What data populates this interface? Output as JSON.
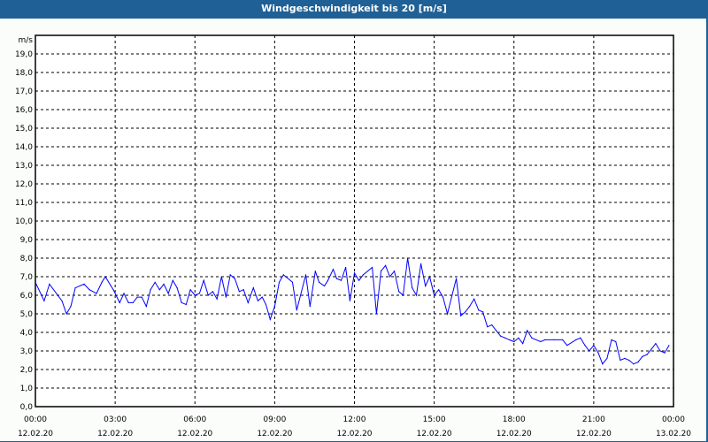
{
  "window_title": "Windgeschwindigkeit bis 20 [m/s]",
  "chart_data": {
    "type": "line",
    "title": "Windgeschwindigkeit bis 20 [m/s]",
    "ylabel": "m/s",
    "xlabel": "",
    "ylim": [
      0,
      20
    ],
    "xlim_hours": [
      0,
      24
    ],
    "grid": true,
    "y_ticks": [
      "0,0",
      "1,0",
      "2,0",
      "3,0",
      "4,0",
      "5,0",
      "6,0",
      "7,0",
      "8,0",
      "9,0",
      "10,0",
      "11,0",
      "12,0",
      "13,0",
      "14,0",
      "15,0",
      "16,0",
      "17,0",
      "18,0",
      "19,0"
    ],
    "x_ticks": [
      {
        "time": "00:00",
        "date": "12.02.20"
      },
      {
        "time": "03:00",
        "date": "12.02.20"
      },
      {
        "time": "06:00",
        "date": "12.02.20"
      },
      {
        "time": "09:00",
        "date": "12.02.20"
      },
      {
        "time": "12:00",
        "date": "12.02.20"
      },
      {
        "time": "15:00",
        "date": "12.02.20"
      },
      {
        "time": "18:00",
        "date": "12.02.20"
      },
      {
        "time": "21:00",
        "date": "12.02.20"
      },
      {
        "time": "00:00",
        "date": "13.02.20"
      }
    ],
    "series": [
      {
        "name": "Windgeschwindigkeit",
        "color": "#0000ff",
        "points": [
          [
            0.03,
            6.6
          ],
          [
            0.33,
            5.7
          ],
          [
            0.53,
            6.6
          ],
          [
            1.0,
            5.7
          ],
          [
            1.17,
            5.0
          ],
          [
            1.33,
            5.4
          ],
          [
            1.5,
            6.4
          ],
          [
            1.83,
            6.6
          ],
          [
            2.03,
            6.3
          ],
          [
            2.3,
            6.1
          ],
          [
            2.5,
            6.7
          ],
          [
            2.63,
            7.0
          ],
          [
            2.93,
            6.3
          ],
          [
            3.17,
            5.6
          ],
          [
            3.33,
            6.1
          ],
          [
            3.5,
            5.6
          ],
          [
            3.67,
            5.6
          ],
          [
            3.83,
            5.9
          ],
          [
            4.0,
            5.9
          ],
          [
            4.17,
            5.4
          ],
          [
            4.33,
            6.3
          ],
          [
            4.5,
            6.7
          ],
          [
            4.67,
            6.3
          ],
          [
            4.83,
            6.6
          ],
          [
            5.0,
            6.1
          ],
          [
            5.17,
            6.8
          ],
          [
            5.33,
            6.4
          ],
          [
            5.5,
            5.6
          ],
          [
            5.67,
            5.5
          ],
          [
            5.83,
            6.3
          ],
          [
            6.0,
            6.0
          ],
          [
            6.17,
            6.1
          ],
          [
            6.33,
            6.8
          ],
          [
            6.5,
            6.0
          ],
          [
            6.67,
            6.2
          ],
          [
            6.83,
            5.8
          ],
          [
            7.0,
            7.0
          ],
          [
            7.17,
            5.9
          ],
          [
            7.33,
            7.1
          ],
          [
            7.5,
            6.9
          ],
          [
            7.67,
            6.2
          ],
          [
            7.83,
            6.3
          ],
          [
            8.0,
            5.6
          ],
          [
            8.2,
            6.4
          ],
          [
            8.37,
            5.7
          ],
          [
            8.53,
            5.9
          ],
          [
            8.67,
            5.5
          ],
          [
            8.83,
            4.7
          ],
          [
            9.0,
            5.4
          ],
          [
            9.17,
            6.7
          ],
          [
            9.33,
            7.1
          ],
          [
            9.67,
            6.7
          ],
          [
            9.83,
            5.2
          ],
          [
            10.17,
            7.1
          ],
          [
            10.33,
            5.4
          ],
          [
            10.53,
            7.3
          ],
          [
            10.67,
            6.7
          ],
          [
            10.87,
            6.5
          ],
          [
            11.0,
            6.8
          ],
          [
            11.2,
            7.4
          ],
          [
            11.33,
            6.9
          ],
          [
            11.5,
            6.8
          ],
          [
            11.67,
            7.5
          ],
          [
            11.83,
            5.7
          ],
          [
            12.0,
            7.2
          ],
          [
            12.17,
            6.8
          ],
          [
            12.33,
            7.1
          ],
          [
            12.67,
            7.5
          ],
          [
            12.83,
            5.0
          ],
          [
            13.0,
            7.3
          ],
          [
            13.17,
            7.6
          ],
          [
            13.33,
            7.0
          ],
          [
            13.5,
            7.3
          ],
          [
            13.67,
            6.2
          ],
          [
            13.83,
            6.0
          ],
          [
            14.0,
            8.0
          ],
          [
            14.17,
            6.4
          ],
          [
            14.33,
            6.0
          ],
          [
            14.5,
            7.7
          ],
          [
            14.67,
            6.5
          ],
          [
            14.83,
            7.0
          ],
          [
            15.0,
            6.0
          ],
          [
            15.17,
            6.3
          ],
          [
            15.33,
            5.9
          ],
          [
            15.5,
            5.0
          ],
          [
            15.67,
            6.0
          ],
          [
            15.83,
            6.9
          ],
          [
            16.0,
            4.9
          ],
          [
            16.17,
            5.1
          ],
          [
            16.33,
            5.4
          ],
          [
            16.5,
            5.8
          ],
          [
            16.67,
            5.2
          ],
          [
            16.83,
            5.1
          ],
          [
            17.0,
            4.3
          ],
          [
            17.17,
            4.4
          ],
          [
            17.33,
            4.1
          ],
          [
            17.5,
            3.8
          ],
          [
            17.67,
            3.7
          ],
          [
            17.83,
            3.6
          ],
          [
            18.0,
            3.5
          ],
          [
            18.17,
            3.7
          ],
          [
            18.33,
            3.4
          ],
          [
            18.5,
            4.1
          ],
          [
            18.67,
            3.7
          ],
          [
            19.0,
            3.5
          ],
          [
            19.17,
            3.6
          ],
          [
            19.5,
            3.6
          ],
          [
            19.83,
            3.6
          ],
          [
            20.0,
            3.3
          ],
          [
            20.33,
            3.6
          ],
          [
            20.5,
            3.7
          ],
          [
            20.67,
            3.3
          ],
          [
            20.83,
            3.0
          ],
          [
            21.0,
            3.3
          ],
          [
            21.17,
            2.9
          ],
          [
            21.33,
            2.3
          ],
          [
            21.5,
            2.6
          ],
          [
            21.67,
            3.6
          ],
          [
            21.83,
            3.5
          ],
          [
            22.0,
            2.5
          ],
          [
            22.17,
            2.6
          ],
          [
            22.33,
            2.5
          ],
          [
            22.5,
            2.3
          ],
          [
            22.67,
            2.4
          ],
          [
            22.83,
            2.7
          ],
          [
            23.0,
            2.8
          ],
          [
            23.17,
            3.1
          ],
          [
            23.33,
            3.4
          ],
          [
            23.5,
            3.0
          ],
          [
            23.67,
            2.9
          ],
          [
            23.83,
            3.3
          ]
        ]
      }
    ]
  }
}
